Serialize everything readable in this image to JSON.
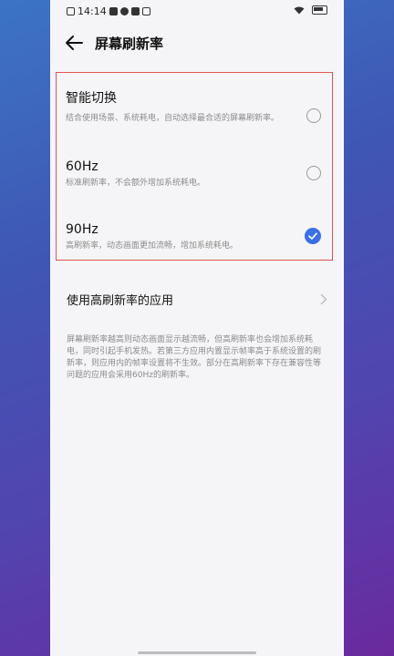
{
  "status_bar": {
    "time": "14:14"
  },
  "header": {
    "title": "屏幕刷新率"
  },
  "options": [
    {
      "title": "智能切换",
      "description": "结合使用场景、系统耗电，自动选择最合适的屏幕刷新率。",
      "selected": false
    },
    {
      "title": "60Hz",
      "description": "标准刷新率，不会额外增加系统耗电。",
      "selected": false
    },
    {
      "title": "90Hz",
      "description": "高刷新率，动态画面更加流畅，增加系统耗电。",
      "selected": true
    }
  ],
  "apps_row": {
    "label": "使用高刷新率的应用"
  },
  "footnote": "屏幕刷新率越高则动态画面显示越流畅，但高刷新率也会增加系统耗电，同时引起手机发热。若第三方应用内置显示帧率高于系统设置的刷新率，则应用内的帧率设置将不生效。部分在高刷新率下存在兼容性等问题的应用会采用60Hz的刷新率。",
  "colors": {
    "accent": "#3b6fe6",
    "highlight_border": "#e0524e"
  }
}
